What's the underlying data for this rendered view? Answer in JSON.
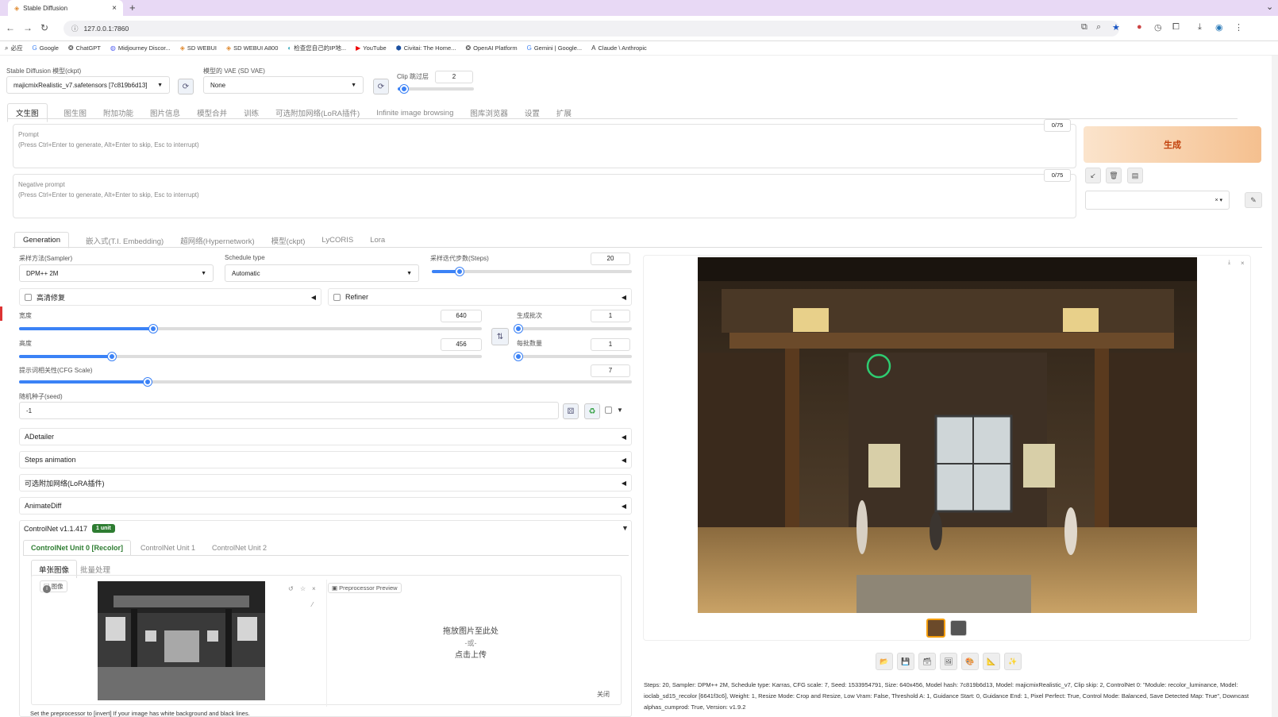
{
  "browser": {
    "tab_title": "Stable Diffusion",
    "url": "127.0.0.1:7860",
    "bookmarks": [
      "必应",
      "Google",
      "ChatGPT",
      "Midjourney Discor...",
      "SD WEBUI",
      "SD WEBUI A800",
      "检查您自己的IP地...",
      "YouTube",
      "Civitai: The Home...",
      "OpenAI Platform",
      "Gemini | Google...",
      "Claude \\ Anthropic"
    ]
  },
  "top": {
    "model_label": "Stable Diffusion 模型(ckpt)",
    "model_value": "majicmixRealistic_v7.safetensors [7c819b6d13]",
    "vae_label": "模型的 VAE (SD VAE)",
    "vae_value": "None",
    "clip_label": "Clip 跳过层",
    "clip_value": "2",
    "clip_fraction": 0.08
  },
  "main_tabs": [
    "文生图",
    "图生图",
    "附加功能",
    "图片信息",
    "模型合并",
    "训练",
    "可选附加网络(LoRA插件)",
    "Infinite image browsing",
    "图库浏览器",
    "设置",
    "扩展"
  ],
  "prompt": {
    "label": "Prompt",
    "placeholder": "(Press Ctrl+Enter to generate, Alt+Enter to skip, Esc to interrupt)",
    "count": "0/75"
  },
  "negative": {
    "label": "Negative prompt",
    "placeholder": "(Press Ctrl+Enter to generate, Alt+Enter to skip, Esc to interrupt)",
    "count": "0/75"
  },
  "generate_label": "生成",
  "sub_tabs": [
    "Generation",
    "嵌入式(T.I. Embedding)",
    "超网络(Hypernetwork)",
    "模型(ckpt)",
    "LyCORIS",
    "Lora"
  ],
  "sampler": {
    "label": "采样方法(Sampler)",
    "value": "DPM++ 2M"
  },
  "schedule": {
    "label": "Schedule type",
    "value": "Automatic"
  },
  "steps": {
    "label": "采样迭代步数(Steps)",
    "value": "20",
    "fraction": 0.14
  },
  "hires_label": "高清修复",
  "refiner_label": "Refiner",
  "width": {
    "label": "宽度",
    "value": "640",
    "fraction": 0.29
  },
  "height": {
    "label": "高度",
    "value": "456",
    "fraction": 0.2
  },
  "batch_count": {
    "label": "生成批次",
    "value": "1",
    "fraction": 0.0
  },
  "batch_size": {
    "label": "每批数量",
    "value": "1",
    "fraction": 0.0
  },
  "cfg": {
    "label": "提示词相关性(CFG Scale)",
    "value": "7",
    "fraction": 0.21
  },
  "seed": {
    "label": "随机种子(seed)",
    "value": "-1"
  },
  "accordions": [
    "ADetailer",
    "Steps animation",
    "可选附加网络(LoRA插件)",
    "AnimateDiff"
  ],
  "controlnet": {
    "title": "ControlNet v1.1.417",
    "badge": "1 unit",
    "unit_tabs": [
      "ControlNet Unit 0 [Recolor]",
      "ControlNet Unit 1",
      "ControlNet Unit 2"
    ],
    "mode_tabs": [
      "单张图像",
      "批量处理"
    ],
    "image_label": "图像",
    "preview_label": "Preprocessor Preview",
    "drop_text": "拖放图片至此处",
    "drop_or": "-或-",
    "drop_click": "点击上传",
    "close_label": "关闭",
    "hint": "Set the preprocessor to [invert] If your image has white background and black lines."
  },
  "info_text": "Steps: 20, Sampler: DPM++ 2M, Schedule type: Karras, CFG scale: 7, Seed: 1533954791, Size: 640x456, Model hash: 7c819b6d13, Model: majicmixRealistic_v7, Clip skip: 2, ControlNet 0: \"Module: recolor_luminance, Model: ioclab_sd15_recolor [6641f3c6], Weight: 1, Resize Mode: Crop and Resize, Low Vram: False, Threshold A: 1, Guidance Start: 0, Guidance End: 1, Pixel Perfect: True, Control Mode: Balanced, Save Detected Map: True\", Downcast alphas_cumprod: True, Version: v1.9.2",
  "colors": {
    "accent": "#3b82f6",
    "generate_bg": "#f6c89c",
    "generate_text": "#c2410c",
    "badge": "#2e7d32"
  }
}
